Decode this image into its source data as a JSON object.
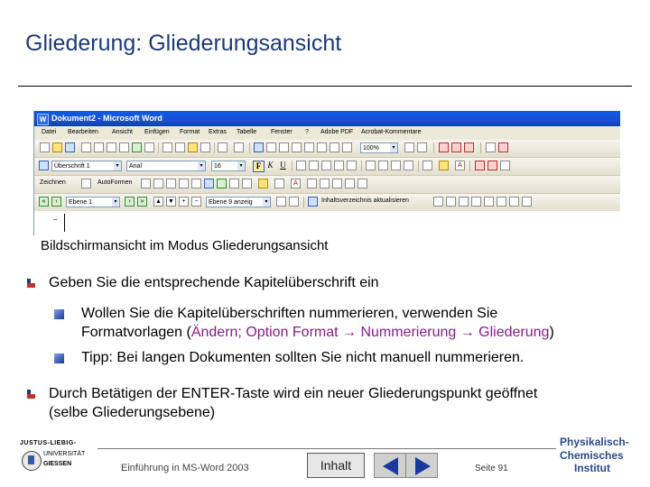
{
  "slide": {
    "title": "Gliederung: Gliederungsansicht",
    "caption": "Bildschirmansicht im Modus Gliederungsansicht"
  },
  "word_window": {
    "title": "Dokument2 - Microsoft Word",
    "menu": [
      "Datei",
      "Bearbeiten",
      "Ansicht",
      "Einfügen",
      "Format",
      "Extras",
      "Tabelle",
      "Fenster",
      "?",
      "Adobe PDF",
      "Acrobat-Kommentare"
    ],
    "zoom": "100%",
    "style_combo": "Überschrift 1",
    "font_combo": "Arial",
    "size_combo": "16",
    "drawing_label": "Zeichnen",
    "autoshapes_label": "AutoFormen",
    "outline_level": "Ebene 1",
    "show_level": "Ebene 9 anzeig",
    "toc_update_label": "Inhaltsverzeichnis aktualisieren",
    "doc_marker": "–"
  },
  "bullets": {
    "b1": "Geben Sie die entsprechende Kapitelüberschrift ein",
    "b2_line1": "Wollen Sie die Kapitelüberschriften nummerieren, verwenden Sie",
    "b2_line2_start": "Formatvorlagen (",
    "b2_line2_purple1": "Ändern; Option Format",
    "b2_arrow1": " → ",
    "b2_line2_purple2": "Nummerierung",
    "b2_arrow2": " → ",
    "b2_line2_purple3": "Gliederung",
    "b2_line2_end": ")",
    "b3": "Tipp: Bei langen Dokumenten sollten Sie nicht manuell nummerieren.",
    "b4_line1": "Durch Betätigen der ENTER-Taste wird ein neuer Gliederungspunkt geöffnet",
    "b4_line2": "(selbe Gliederungsebene)"
  },
  "footer": {
    "uni_line1": "JUSTUS-LIEBIG-",
    "uni_line2": "UNIVERSITÄT",
    "uni_line3": "GIESSEN",
    "course": "Einführung in MS-Word 2003",
    "inhalt_button": "Inhalt",
    "page": "Seite 91",
    "institute_line1": "Physikalisch-",
    "institute_line2": "Chemisches",
    "institute_line3": "Institut"
  },
  "colors": {
    "title": "#1a3a78",
    "highlight": "#8a1a8a",
    "nav_arrow": "#1a3a9a"
  }
}
